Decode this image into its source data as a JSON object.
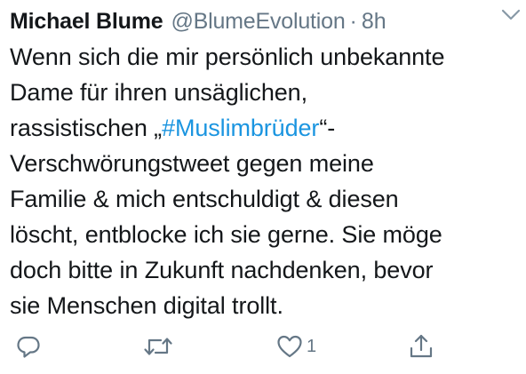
{
  "tweet": {
    "author_name": "Michael Blume",
    "handle": "@BlumeEvolution",
    "separator": "·",
    "time": "8h",
    "menu_icon": "chevron-down-icon",
    "text_lines": [
      {
        "parts": [
          {
            "text": "Wenn sich die mir persönlich unbekannte"
          }
        ]
      },
      {
        "parts": [
          {
            "text": "Dame für ihren unsäglichen,"
          }
        ]
      },
      {
        "parts": [
          {
            "text": "rassistischen „"
          },
          {
            "text": "#Muslimbrüder",
            "hashtag": true
          },
          {
            "text": "“-"
          }
        ]
      },
      {
        "parts": [
          {
            "text": "Verschwörungstweet gegen meine"
          }
        ]
      },
      {
        "parts": [
          {
            "text": "Familie & mich entschuldigt & diesen"
          }
        ]
      },
      {
        "parts": [
          {
            "text": "löscht, entblocke ich sie gerne. Sie möge"
          }
        ]
      },
      {
        "parts": [
          {
            "text": "doch bitte in Zukunft nachdenken, bevor"
          }
        ]
      },
      {
        "parts": [
          {
            "text": "sie Menschen digital trollt."
          }
        ]
      }
    ]
  },
  "actions": {
    "reply": {
      "icon": "reply-icon"
    },
    "retweet": {
      "icon": "retweet-icon"
    },
    "like": {
      "icon": "heart-icon",
      "count": "1"
    },
    "share": {
      "icon": "share-icon"
    }
  },
  "colors": {
    "text": "#14171a",
    "secondary": "#657786",
    "link": "#1b95e0",
    "background": "#ffffff"
  }
}
